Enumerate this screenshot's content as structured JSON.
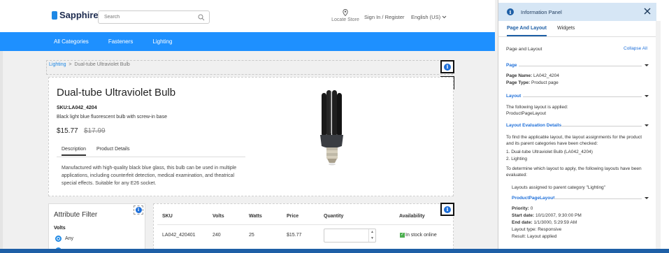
{
  "header": {
    "brand": "Sapphire",
    "search_placeholder": "Search",
    "locate_store": "Locate Store",
    "sign_in": "Sign In / Register",
    "language": "English (US)"
  },
  "nav": {
    "items": [
      "All Categories",
      "Fasteners",
      "Lighting"
    ]
  },
  "breadcrumb": {
    "parent": "Lighting",
    "separator": ">",
    "current": "Dual-tube Ultraviolet Bulb"
  },
  "product": {
    "title": "Dual-tube Ultraviolet Bulb",
    "sku": "SKU:LA042_4204",
    "short_description": "Black light blue fluorescent bulb with screw-in base",
    "price": "$15.77",
    "old_price": "$17.99",
    "tabs": [
      "Description",
      "Product Details"
    ],
    "description": "Manufactured with high-quality black blue glass, this bulb can be used in multiple applications, including counterfeit detection, medical examination, and theatrical special effects. Suitable for any E26 socket."
  },
  "filter": {
    "title": "Attribute Filter",
    "group": "Volts",
    "option_any": "Any"
  },
  "variants": {
    "columns": [
      "SKU",
      "Volts",
      "Watts",
      "Price",
      "Quantity",
      "Availability"
    ],
    "rows": [
      {
        "sku": "LA042_420401",
        "volts": "240",
        "watts": "25",
        "price": "$15.77",
        "availability": "In stock online"
      }
    ]
  },
  "info_icon": "i",
  "panel": {
    "title": "Information Panel",
    "tabs": [
      "Page And Layout",
      "Widgets"
    ],
    "heading": "Page and Layout",
    "collapse_all": "Collapse All",
    "page_section": "Page",
    "page_name_label": "Page Name:",
    "page_name": "LA042_4204",
    "page_type_label": "Page Type:",
    "page_type": "Product page",
    "layout_section": "Layout",
    "layout_text": "The following layout is applied:",
    "layout_name": "ProductPageLayout",
    "eval_section": "Layout Evaluation Details",
    "eval_text_1": "To find the applicable layout, the layout assignments for the product",
    "eval_text_2": "and its parent categories have been checked:",
    "eval_item_1": "1. Dual-tube Ultraviolet Bulb (LA042_4204)",
    "eval_item_2": "2. Lighting",
    "eval_text_3": "To determine which layout to apply, the following layouts have been",
    "eval_text_4": "evaluated:",
    "assigned_text": "Layouts assigned to parent category \"Lighting\"",
    "subsection": "ProductPageLayout",
    "priority_label": "Priority:",
    "priority": "0",
    "start_label": "Start date:",
    "start_date": "10/1/2007, 9:30:00 PM",
    "end_label": "End date:",
    "end_date": "1/1/3000, 5:29:59 AM",
    "layout_type": "Layout type: Responsive",
    "result": "Result: Layout applied"
  }
}
